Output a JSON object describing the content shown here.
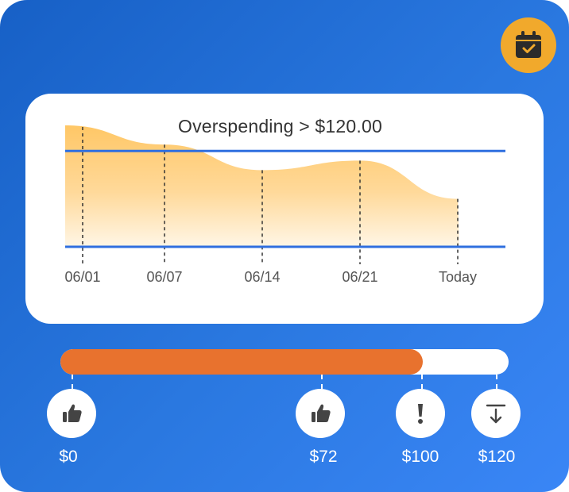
{
  "colors": {
    "background_start": "#1760c6",
    "background_end": "#3a86f6",
    "calendar_button": "#f1a92c",
    "progress_fill": "#e8722e",
    "threshold_line": "#2f6fdf",
    "area_top": "#ffc766"
  },
  "header": {
    "calendar_icon": "calendar-check-icon"
  },
  "chart_data": {
    "type": "area",
    "title": "Overspending > $120.00",
    "x": [
      "06/01",
      "06/07",
      "06/14",
      "06/21",
      "Today"
    ],
    "series": [
      {
        "values": [
          152,
          128,
          96,
          108,
          60
        ]
      }
    ],
    "threshold": 120,
    "ylim": [
      0,
      160
    ],
    "grid": false
  },
  "progress": {
    "value": 100,
    "max": 120,
    "markers": [
      {
        "label": "$0",
        "value": 0,
        "icon": "thumbs-up-icon"
      },
      {
        "label": "$72",
        "value": 72,
        "icon": "thumbs-up-icon"
      },
      {
        "label": "$100",
        "value": 100,
        "icon": "exclamation-icon"
      },
      {
        "label": "$120",
        "value": 120,
        "icon": "download-limit-icon"
      }
    ]
  }
}
